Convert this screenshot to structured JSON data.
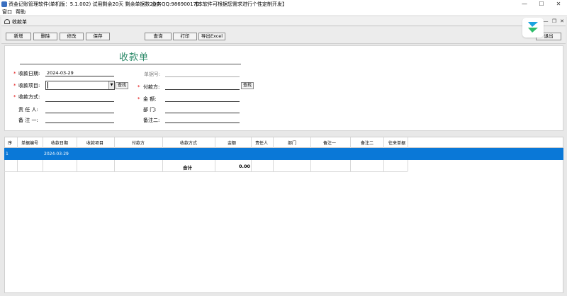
{
  "titlebar": {
    "title": "资金记账管理软件(单机版：5.1.002)  试用剩余20天  剩余单据数200",
    "qq": "业务QQ:986900170",
    "notice": "【本软件可根据您需求进行个性定制开发】",
    "min": "—",
    "max": "☐",
    "close": "✕"
  },
  "menu": {
    "window": "窗口",
    "help": "帮助"
  },
  "child": {
    "title": "收款单"
  },
  "toolbar": {
    "add": "新增",
    "delete": "删除",
    "edit": "修改",
    "save": "保存",
    "query": "查询",
    "print": "打印",
    "export": "导出Excel",
    "exit": "退出"
  },
  "form": {
    "title": "收款单",
    "date_label": "收款日期:",
    "date_value": "2024-03-29",
    "doc_no_label": "单据号:",
    "item_label": "收款项目:",
    "payer_label": "付款方:",
    "method_label": "收款方式:",
    "amount_label": "金    额:",
    "person_label": "责 任 人:",
    "dept_label": "部    门:",
    "note1_label": "备 注 一:",
    "note2_label": "备注二:",
    "lookup": "查找",
    "required_mark": "*"
  },
  "grid": {
    "headers": [
      "序",
      "单据编号",
      "收款日期",
      "收款项目",
      "付款方",
      "收款方式",
      "金额",
      "责任人",
      "部门",
      "备注一",
      "备注二",
      "往来单据"
    ],
    "rows": [
      {
        "seq": "1",
        "date": "2024-03-29"
      }
    ],
    "total_label": "合计",
    "total_value": "0.00"
  },
  "colors": {
    "accent": "#0a78d7",
    "title_green": "#2e8b6a",
    "required": "#e00000"
  }
}
